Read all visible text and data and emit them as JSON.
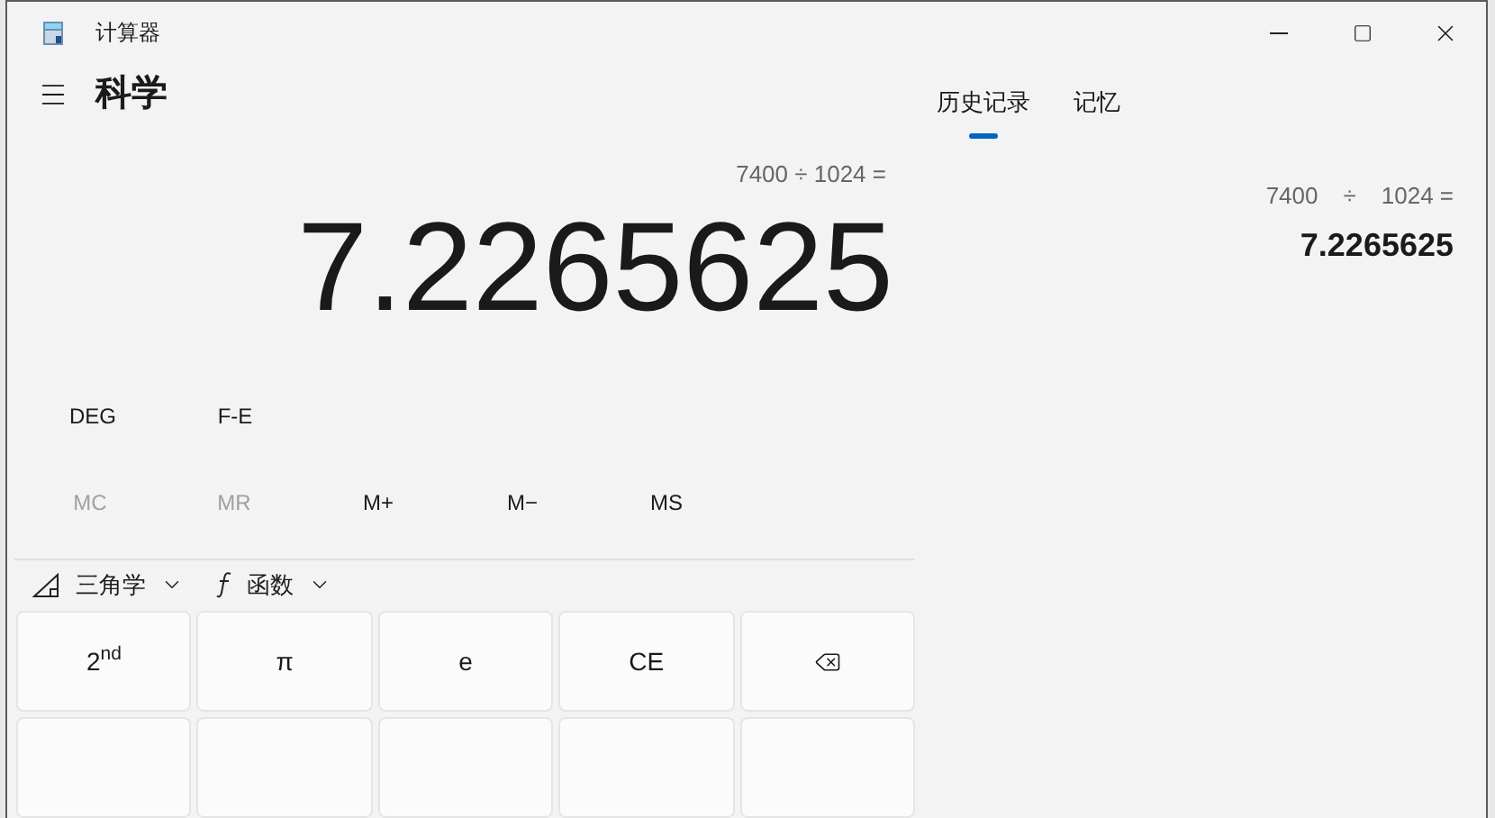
{
  "window": {
    "title": "计算器"
  },
  "mode": {
    "title": "科学"
  },
  "display": {
    "expression": "7400 ÷ 1024 =",
    "value": "7.2265625"
  },
  "toggles": [
    "DEG",
    "F-E"
  ],
  "memory": [
    {
      "label": "MC",
      "disabled": true
    },
    {
      "label": "MR",
      "disabled": true
    },
    {
      "label": "M+",
      "disabled": false
    },
    {
      "label": "M−",
      "disabled": false
    },
    {
      "label": "MS",
      "disabled": false
    }
  ],
  "function_menus": [
    {
      "kind": "trig",
      "label": "三角学"
    },
    {
      "kind": "func",
      "label": "函数"
    }
  ],
  "keys": [
    {
      "kind": "text",
      "label": "2$^{nd}$"
    },
    {
      "kind": "text",
      "label": "π"
    },
    {
      "kind": "text",
      "label": "e"
    },
    {
      "kind": "text",
      "label": "CE"
    },
    {
      "kind": "backspace"
    }
  ],
  "tabs": [
    {
      "label": "历史记录",
      "selected": true
    },
    {
      "label": "记忆",
      "selected": false
    }
  ],
  "history": [
    {
      "operand_1": "7400",
      "operator": "÷",
      "operand_2": "1024 =",
      "result": "7.2265625"
    }
  ]
}
